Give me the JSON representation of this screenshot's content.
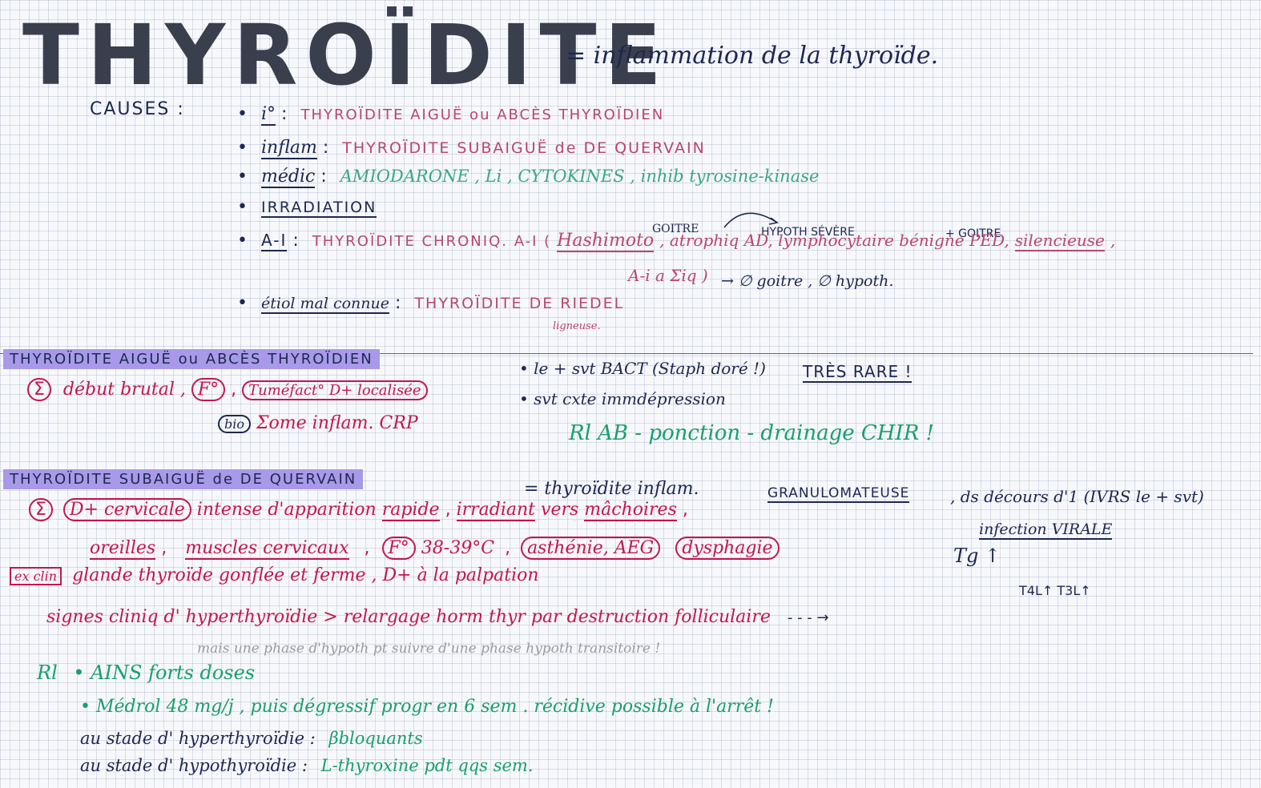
{
  "title": "THYROÏDITE",
  "definition": "= inflammation de la thyroïde.",
  "causes": {
    "label": "CAUSES :",
    "items": [
      {
        "bullet": "•",
        "key": "i°",
        "sep": ":",
        "text": "THYROÏDITE AIGUË ou ABCÈS THYROÏDIEN"
      },
      {
        "bullet": "•",
        "key": "inflam",
        "sep": ":",
        "text": "THYROÏDITE SUBAIGUË de DE QUERVAIN"
      },
      {
        "bullet": "•",
        "key": "médic",
        "sep": ":",
        "text": "AMIODARONE , Li , CYTOKINES , inhib tyrosine-kinase"
      },
      {
        "bullet": "•",
        "key": "IRRADIATION",
        "sep": "",
        "text": ""
      },
      {
        "bullet": "•",
        "key": "A-I",
        "sep": ":",
        "text": "THYROÏDITE CHRONIQ. A-I ("
      },
      {
        "bullet": "•",
        "key": "étiol mal connue",
        "sep": ":",
        "text": "THYROÏDITE DE RIEDEL"
      }
    ],
    "ai_detail": {
      "hashimoto": "Hashimoto",
      "rest": ", atrophiq AD, lymphocytaire bénigne PED,",
      "silent": "silencieuse",
      "comma": ",",
      "line2": "A-i a Σiq )",
      "goitre": "GOITRE",
      "hypoth_severe": "HYPOTH SÉVÈRE",
      "plus_goitre": "+ GOITRE",
      "no_goitre": "→ ∅ goitre , ∅ hypoth."
    },
    "riedel_sub": "ligneuse."
  },
  "section1": {
    "heading": "THYROÏDITE AIGUË ou ABCÈS THYROÏDIEN",
    "sigma": "Σ",
    "debut": "début brutal ,",
    "fever": "F°",
    "comma": ",",
    "tumefaction": "Tuméfact° D+ localisée",
    "bio": "bio",
    "bio_text": "Σome inflam. CRP",
    "note1": "• le + svt BACT (Staph doré !)",
    "rare": "TRÈS RARE !",
    "note2": "• svt cxte immdépression",
    "treatment": "Rl   AB - ponction - drainage CHIR !"
  },
  "section2": {
    "heading": "THYROÏDITE SUBAIGUË de DE QUERVAIN",
    "definition": "= thyroïdite inflam.",
    "granulo": "GRANULOMATEUSE",
    "decours": ", ds décours d'1 (IVRS le + svt)",
    "infection": "infection VIRALE",
    "sigma": "Σ",
    "cervical": "D+ cervicale",
    "intense": "intense d'apparition",
    "rapide": "rapide",
    "comma1": ",",
    "irradiant": "irradiant",
    "vers": "vers",
    "machoires": "mâchoires",
    "comma2": ",",
    "oreilles": "oreilles",
    "comma3": ",",
    "muscles": "muscles cervicaux",
    "comma4": ",",
    "fever": "F°",
    "temp": "38-39°C",
    "comma5": ",",
    "asthenie": "asthénie, AEG",
    "dysphagie": "dysphagie",
    "tg": "Tg ↑",
    "exclin": "ex clin",
    "glande": "glande thyroïde gonflée et ferme , D+ à la palpation",
    "t4t3": "T4L↑ T3L↑",
    "signes": "signes cliniq d' hyperthyroïdie > relargage horm thyr par destruction folliculaire",
    "arrow": "- - - →",
    "mais": "mais une phase d'hypoth pt suivre d'une phase hypoth transitoire !",
    "rl": "Rl",
    "ains": "• AINS forts doses",
    "medrol": "• Médrol 48 mg/j , puis dégressif progr en 6 sem . récidive possible à l'arrêt !",
    "stade1_pre": "au stade d' hyperthyroïdie :",
    "stade1_tt": "βbloquants",
    "stade2_pre": "au stade d' hypothyroïdie :",
    "stade2_tt": "L-thyroxine pdt qqs sem."
  }
}
